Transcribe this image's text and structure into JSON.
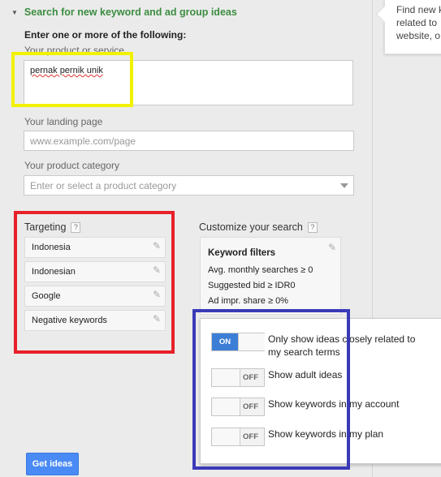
{
  "header": {
    "section_title": "Search for new keyword and ad group ideas"
  },
  "help_panel": {
    "text": "Find new k\nrelated to\nwebsite, o"
  },
  "form": {
    "instruction": "Enter one or more of the following:",
    "product_label": "Your product or service",
    "product_value": "pernak pernik unik",
    "landing_label": "Your landing page",
    "landing_placeholder": "www.example.com/page",
    "category_label": "Your product category",
    "category_placeholder": "Enter or select a product category"
  },
  "targeting": {
    "title": "Targeting",
    "help": "?",
    "items": [
      "Indonesia",
      "Indonesian",
      "Google",
      "Negative keywords"
    ]
  },
  "customize": {
    "title": "Customize your search",
    "help": "?",
    "filters_title": "Keyword filters",
    "filters": [
      "Avg. monthly searches ≥ 0",
      "Suggested bid ≥ IDR0",
      "Ad impr. share ≥ 0%"
    ]
  },
  "options": [
    {
      "state": "ON",
      "label": "Only show ideas closely related to my search terms"
    },
    {
      "state": "OFF",
      "label": "Show adult ideas"
    },
    {
      "state": "OFF",
      "label": "Show keywords in my account"
    },
    {
      "state": "OFF",
      "label": "Show keywords in my plan"
    }
  ],
  "actions": {
    "get_ideas": "Get ideas"
  },
  "colors": {
    "accent_green": "#3c8d40",
    "toggle_on": "#3c7ed5",
    "button_blue": "#4a8af4",
    "highlight_yellow": "#f2f200",
    "highlight_red": "#e8202a",
    "highlight_blue": "#3a3ab8"
  },
  "icons": {
    "collapse": "triangle-down-icon",
    "edit": "pencil-icon",
    "help": "question-mark-icon",
    "dropdown": "chevron-down-icon"
  }
}
